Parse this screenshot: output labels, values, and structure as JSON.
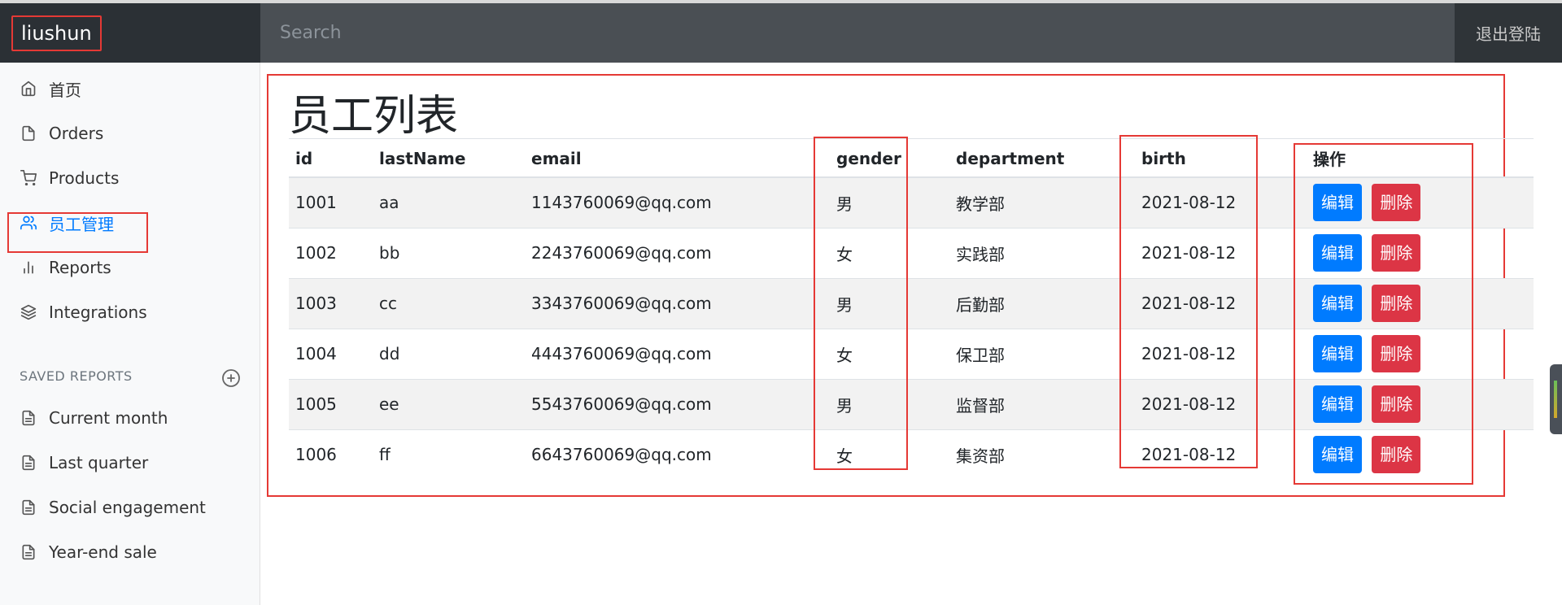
{
  "header": {
    "brand": "liushun",
    "search_placeholder": "Search",
    "logout_label": "退出登陆"
  },
  "sidebar": {
    "items": [
      {
        "label": "首页",
        "icon": "home-icon"
      },
      {
        "label": "Orders",
        "icon": "file-icon"
      },
      {
        "label": "Products",
        "icon": "shopping-cart-icon"
      },
      {
        "label": "员工管理",
        "icon": "users-icon",
        "active": true
      },
      {
        "label": "Reports",
        "icon": "bar-chart-icon"
      },
      {
        "label": "Integrations",
        "icon": "layers-icon"
      }
    ],
    "saved_reports_title": "SAVED REPORTS",
    "saved_reports": [
      {
        "label": "Current month"
      },
      {
        "label": "Last quarter"
      },
      {
        "label": "Social engagement"
      },
      {
        "label": "Year-end sale"
      }
    ]
  },
  "main": {
    "title": "员工列表",
    "columns": [
      "id",
      "lastName",
      "email",
      "gender",
      "department",
      "birth",
      "操作"
    ],
    "rows": [
      [
        "1001",
        "aa",
        "1143760069@qq.com",
        "男",
        "教学部",
        "2021-08-12"
      ],
      [
        "1002",
        "bb",
        "2243760069@qq.com",
        "女",
        "实践部",
        "2021-08-12"
      ],
      [
        "1003",
        "cc",
        "3343760069@qq.com",
        "男",
        "后勤部",
        "2021-08-12"
      ],
      [
        "1004",
        "dd",
        "4443760069@qq.com",
        "女",
        "保卫部",
        "2021-08-12"
      ],
      [
        "1005",
        "ee",
        "5543760069@qq.com",
        "男",
        "监督部",
        "2021-08-12"
      ],
      [
        "1006",
        "ff",
        "6643760069@qq.com",
        "女",
        "集资部",
        "2021-08-12"
      ]
    ],
    "edit_label": "编辑",
    "delete_label": "删除"
  },
  "colors": {
    "primary": "#007bff",
    "danger": "#dc3545",
    "highlight": "#e53935",
    "topbar": "#343a40"
  }
}
